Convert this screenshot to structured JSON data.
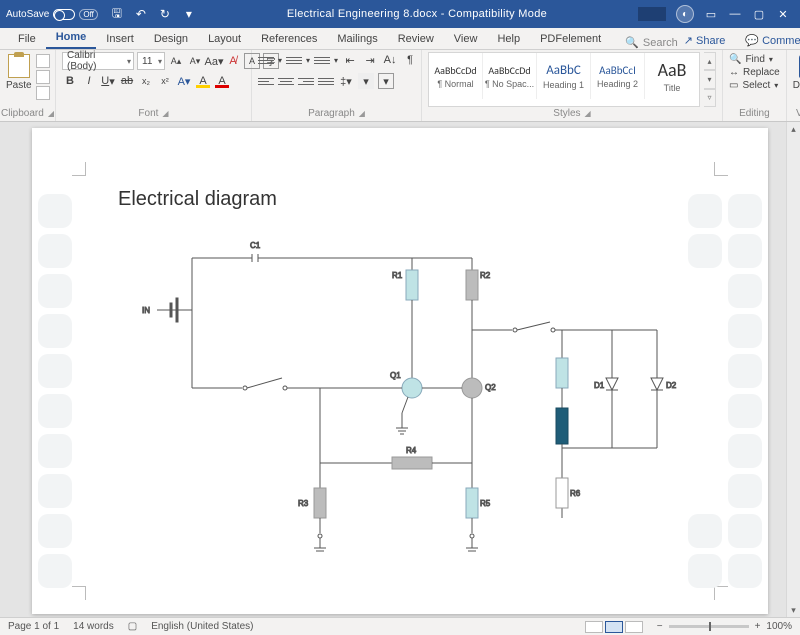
{
  "titlebar": {
    "autosave_label": "AutoSave",
    "autosave_state": "Off",
    "doc_title": "Electrical Engineering 8.docx - Compatibility Mode"
  },
  "menu": {
    "tabs": [
      "File",
      "Home",
      "Insert",
      "Design",
      "Layout",
      "References",
      "Mailings",
      "Review",
      "View",
      "Help",
      "PDFelement"
    ],
    "active_index": 1,
    "search_placeholder": "Search",
    "share_label": "Share",
    "comments_label": "Comments"
  },
  "ribbon": {
    "clipboard": {
      "paste_label": "Paste",
      "group_label": "Clipboard"
    },
    "font": {
      "font_name": "Calibri (Body)",
      "font_size": "11",
      "group_label": "Font"
    },
    "paragraph": {
      "group_label": "Paragraph"
    },
    "styles": {
      "group_label": "Styles",
      "items": [
        {
          "preview": "AaBbCcDd",
          "name": "¶ Normal",
          "cls": "sp-normal"
        },
        {
          "preview": "AaBbCcDd",
          "name": "¶ No Spac...",
          "cls": "sp-normal"
        },
        {
          "preview": "AaBbC",
          "name": "Heading 1",
          "cls": "sp-h1"
        },
        {
          "preview": "AaBbCcI",
          "name": "Heading 2",
          "cls": "sp-h2"
        },
        {
          "preview": "AaB",
          "name": "Title",
          "cls": "sp-title"
        }
      ]
    },
    "editing": {
      "find": "Find",
      "replace": "Replace",
      "select": "Select",
      "group_label": "Editing"
    },
    "voice": {
      "dictate": "Dictate",
      "group_label": "Voice"
    }
  },
  "document": {
    "heading": "Electrical diagram",
    "labels": {
      "IN": "IN",
      "C1": "C1",
      "R1": "R1",
      "R2": "R2",
      "Q1": "Q1",
      "Q2": "Q2",
      "R3": "R3",
      "R4": "R4",
      "R5": "R5",
      "R6": "R6",
      "D1": "D1",
      "D2": "D2"
    }
  },
  "status": {
    "page": "Page 1 of 1",
    "words": "14 words",
    "language": "English (United States)",
    "zoom": "100%"
  }
}
